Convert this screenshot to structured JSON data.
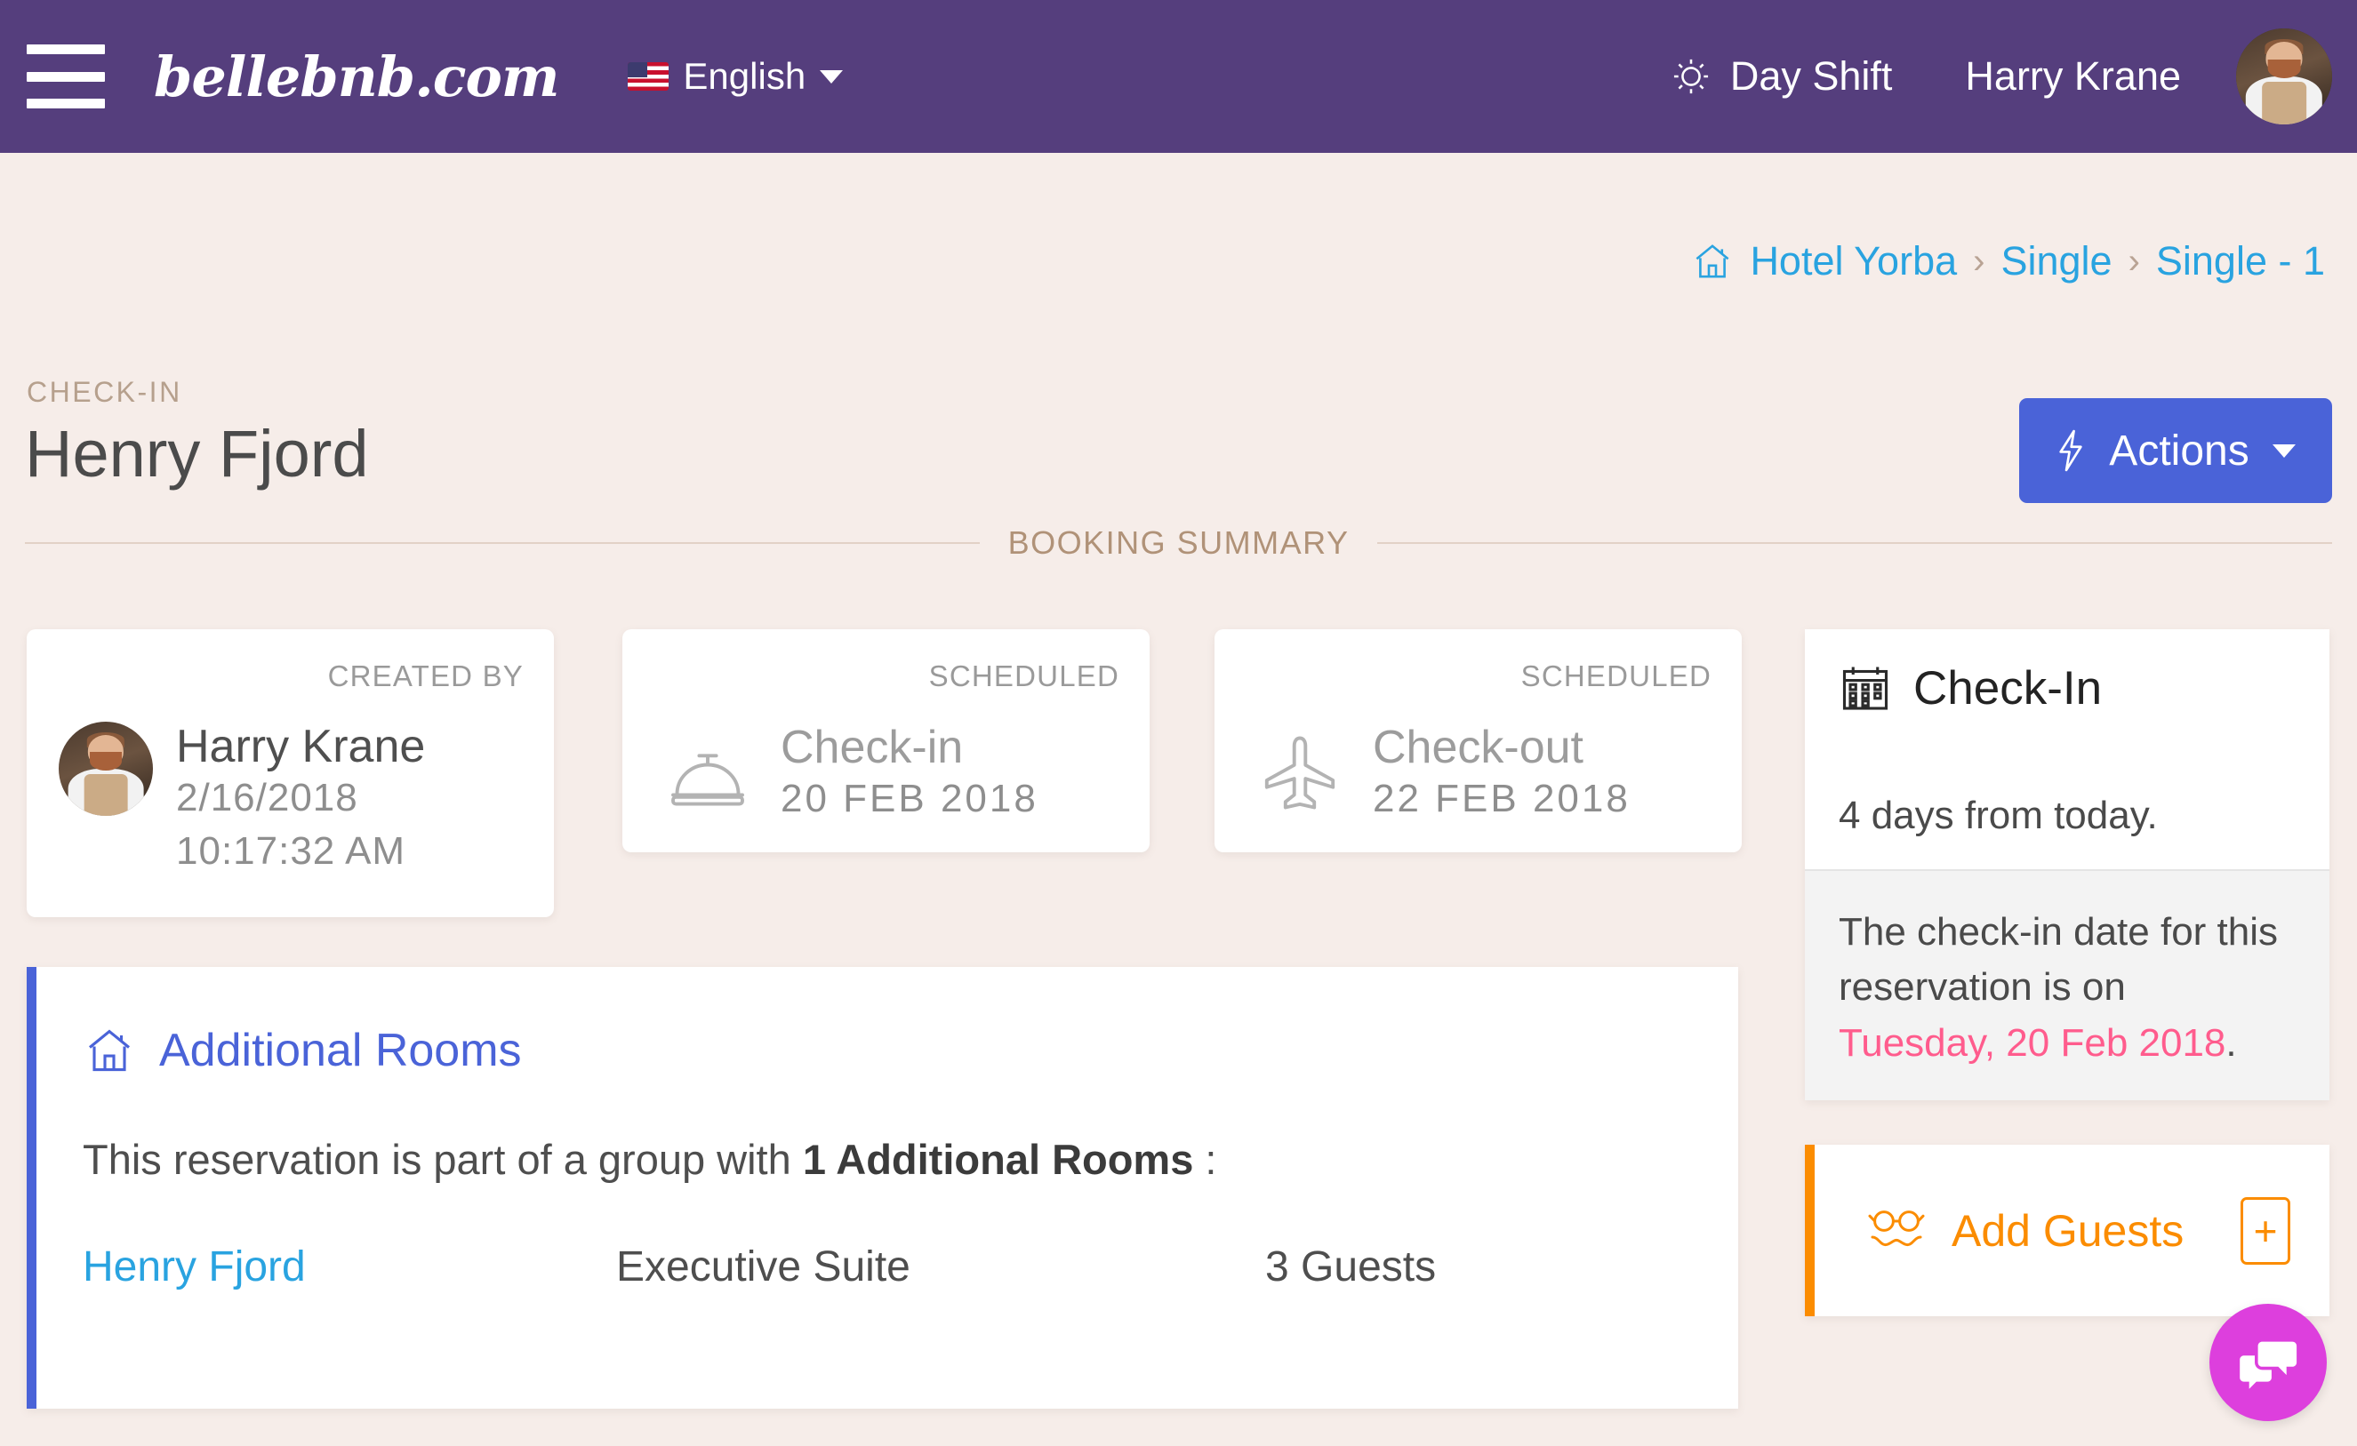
{
  "topbar": {
    "brand": "bellebnb.com",
    "language": "English",
    "shift": "Day Shift",
    "user": "Harry Krane"
  },
  "breadcrumb": {
    "items": [
      "Hotel Yorba",
      "Single",
      "Single - 1"
    ],
    "separator": "›"
  },
  "page": {
    "kicker": "CHECK-IN",
    "title": "Henry Fjord",
    "actions_label": "Actions",
    "section_label": "BOOKING SUMMARY"
  },
  "cards": {
    "created": {
      "kicker": "CREATED BY",
      "name": "Harry Krane",
      "date": "2/16/2018",
      "time": "10:17:32 AM"
    },
    "checkin": {
      "kicker": "SCHEDULED",
      "title": "Check-in",
      "date": "20 FEB 2018"
    },
    "checkout": {
      "kicker": "SCHEDULED",
      "title": "Check-out",
      "date": "22 FEB 2018"
    }
  },
  "additional_rooms": {
    "heading": "Additional Rooms",
    "description_prefix": "This reservation is part of a group with ",
    "description_count": "1 Additional Rooms",
    "description_suffix": " :",
    "row": {
      "guest": "Henry Fjord",
      "room": "Executive Suite",
      "guests": "3 Guests"
    }
  },
  "checkin_panel": {
    "title": "Check-In",
    "subtitle": "4 days from today.",
    "note_prefix": "The check-in date for this reservation is on ",
    "note_date": "Tuesday, 20 Feb 2018",
    "note_suffix": "."
  },
  "add_guests": {
    "label": "Add Guests",
    "add_symbol": "+"
  },
  "colors": {
    "header_purple": "#553e7d",
    "page_bg": "#f6ede9",
    "accent_blue": "#4a63d8",
    "link_blue": "#29a3e0",
    "orange": "#fb8c00",
    "pink": "#ff5c8d",
    "chat_magenta": "#dd3fdd"
  }
}
